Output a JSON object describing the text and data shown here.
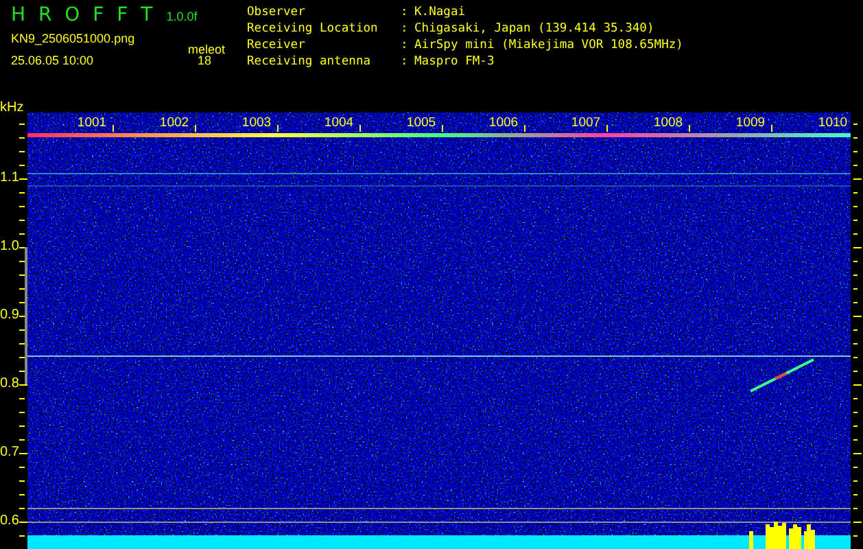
{
  "header": {
    "title": "H R O F F T",
    "version": "1.0.0f",
    "filename": "KN9_2506051000.png",
    "datetime": "25.06.05 10:00",
    "count_label": "meleot",
    "count": "18"
  },
  "info": [
    {
      "label": "Observer",
      "separator": ":",
      "value": "K.Nagai"
    },
    {
      "label": "Receiving Location",
      "separator": ":",
      "value": "Chigasaki, Japan (139.414 35.340)"
    },
    {
      "label": "Receiver",
      "separator": ":",
      "value": "AirSpy mini (Miakejima VOR 108.65MHz)"
    },
    {
      "label": "Receiving antenna",
      "separator": ":",
      "value": "Maspro FM-3"
    }
  ],
  "waterfall": {
    "unit": "kHz",
    "x_labels": [
      "1001",
      "1002",
      "1003",
      "1004",
      "1005",
      "1006",
      "1007",
      "1008",
      "1009",
      "1010"
    ],
    "y_labels": [
      "1.1",
      "1.0",
      "0.9",
      "0.8",
      "0.7",
      "0.6"
    ]
  }
}
